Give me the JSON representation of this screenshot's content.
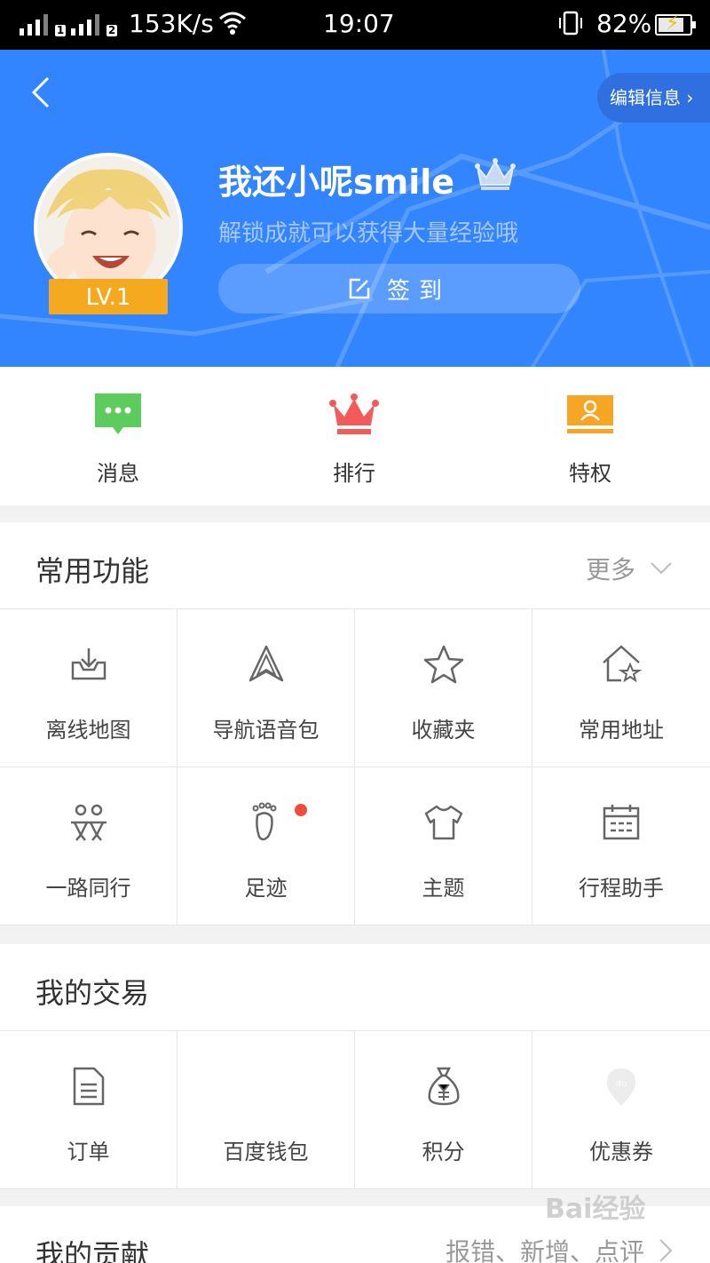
{
  "status_bar": {
    "network_speed": "153K/s",
    "time": "19:07",
    "battery": "82%",
    "sim1": "1",
    "sim2": "2"
  },
  "header": {
    "back_icon": "chevron-left-icon",
    "edit_label": "编辑信息",
    "username": "我还小呢smile",
    "level": "LV.1",
    "subtitle": "解锁成就可以获得大量经验哦",
    "signin_label": "签到",
    "colors": {
      "brand": "#3385ff",
      "level_badge": "#f5a91f"
    }
  },
  "quick_actions": [
    {
      "label": "消息",
      "icon": "message-icon",
      "color": "#5ccd5c"
    },
    {
      "label": "排行",
      "icon": "crown-icon",
      "color": "#f55a5a"
    },
    {
      "label": "特权",
      "icon": "privilege-card-icon",
      "color": "#f7a524"
    }
  ],
  "common": {
    "title": "常用功能",
    "more": "更多",
    "items": [
      {
        "label": "离线地图",
        "icon": "download-tray-icon"
      },
      {
        "label": "导航语音包",
        "icon": "navigation-arrow-icon"
      },
      {
        "label": "收藏夹",
        "icon": "star-icon"
      },
      {
        "label": "常用地址",
        "icon": "home-star-icon"
      },
      {
        "label": "一路同行",
        "icon": "people-icon"
      },
      {
        "label": "足迹",
        "icon": "footprint-icon"
      },
      {
        "label": "主题",
        "icon": "tshirt-icon"
      },
      {
        "label": "行程助手",
        "icon": "calendar-icon"
      }
    ]
  },
  "trade": {
    "title": "我的交易",
    "items": [
      {
        "label": "订单",
        "icon": "document-icon"
      },
      {
        "label": "百度钱包",
        "icon": ""
      },
      {
        "label": "积分",
        "icon": "money-bag-icon"
      },
      {
        "label": "优惠券",
        "icon": "coupon-pin-icon"
      }
    ]
  },
  "contribution": {
    "title": "我的贡献",
    "more": "报错、新增、点评"
  },
  "watermark": "Bai经验"
}
